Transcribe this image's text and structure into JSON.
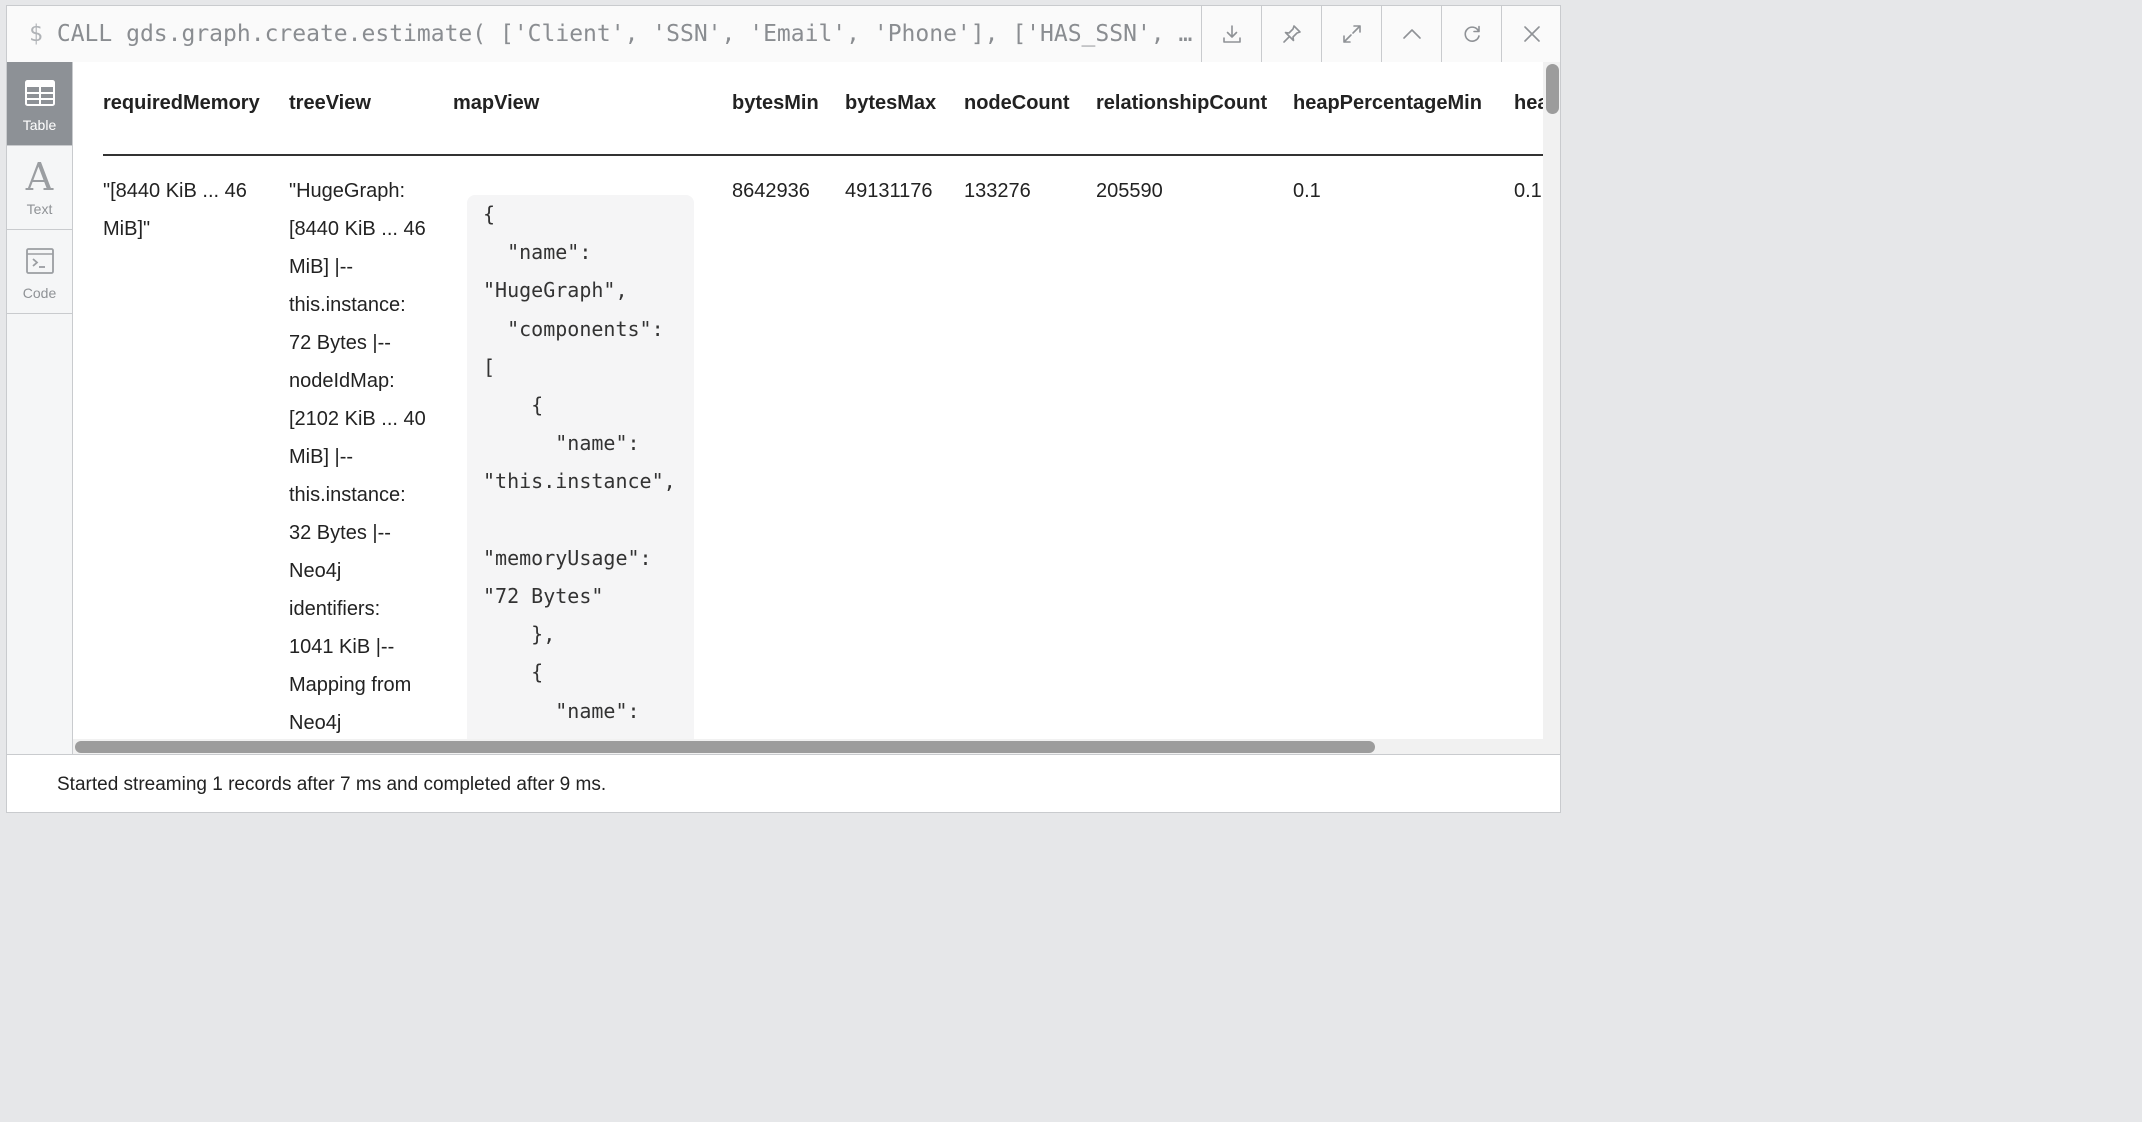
{
  "query": {
    "prompt": "$",
    "text": "CALL gds.graph.create.estimate( ['Client', 'SSN', 'Email', 'Phone'], ['HAS_SSN', …"
  },
  "toolbar": {
    "icons": [
      "download-icon",
      "pin-icon",
      "expand-icon",
      "collapse-up-icon",
      "rerun-icon",
      "close-icon"
    ]
  },
  "views": [
    {
      "label": "Table",
      "icon": "table-icon",
      "active": true
    },
    {
      "label": "Text",
      "icon": "text-icon",
      "active": false
    },
    {
      "label": "Code",
      "icon": "code-icon",
      "active": false
    }
  ],
  "table": {
    "columns": [
      "requiredMemory",
      "treeView",
      "mapView",
      "bytesMin",
      "bytesMax",
      "nodeCount",
      "relationshipCount",
      "heapPercentageMin",
      "hea"
    ],
    "row": {
      "requiredMemory": [
        "\"[8440 KiB ... 46",
        "MiB]\""
      ],
      "treeView": [
        "\"HugeGraph:",
        "[8440 KiB ... 46",
        "MiB] |--",
        "this.instance:",
        "72 Bytes |--",
        "nodeIdMap:",
        "[2102 KiB ... 40",
        "MiB] |--",
        "this.instance:",
        "32 Bytes |--",
        "Neo4j",
        "identifiers:",
        "1041 KiB |--",
        "Mapping from",
        "Neo4j"
      ],
      "mapView": "{\n  \"name\":\n\"HugeGraph\",\n  \"components\":\n[\n    {\n      \"name\":\n\"this.instance\",\n\n\"memoryUsage\":\n\"72 Bytes\"\n    },\n    {\n      \"name\":",
      "bytesMin": "8642936",
      "bytesMax": "49131176",
      "nodeCount": "133276",
      "relationshipCount": "205590",
      "heapPercentageMin": "0.1",
      "heapPercentageMax": "0.1"
    }
  },
  "status": "Started streaming 1 records after 7 ms and completed after 9 ms."
}
